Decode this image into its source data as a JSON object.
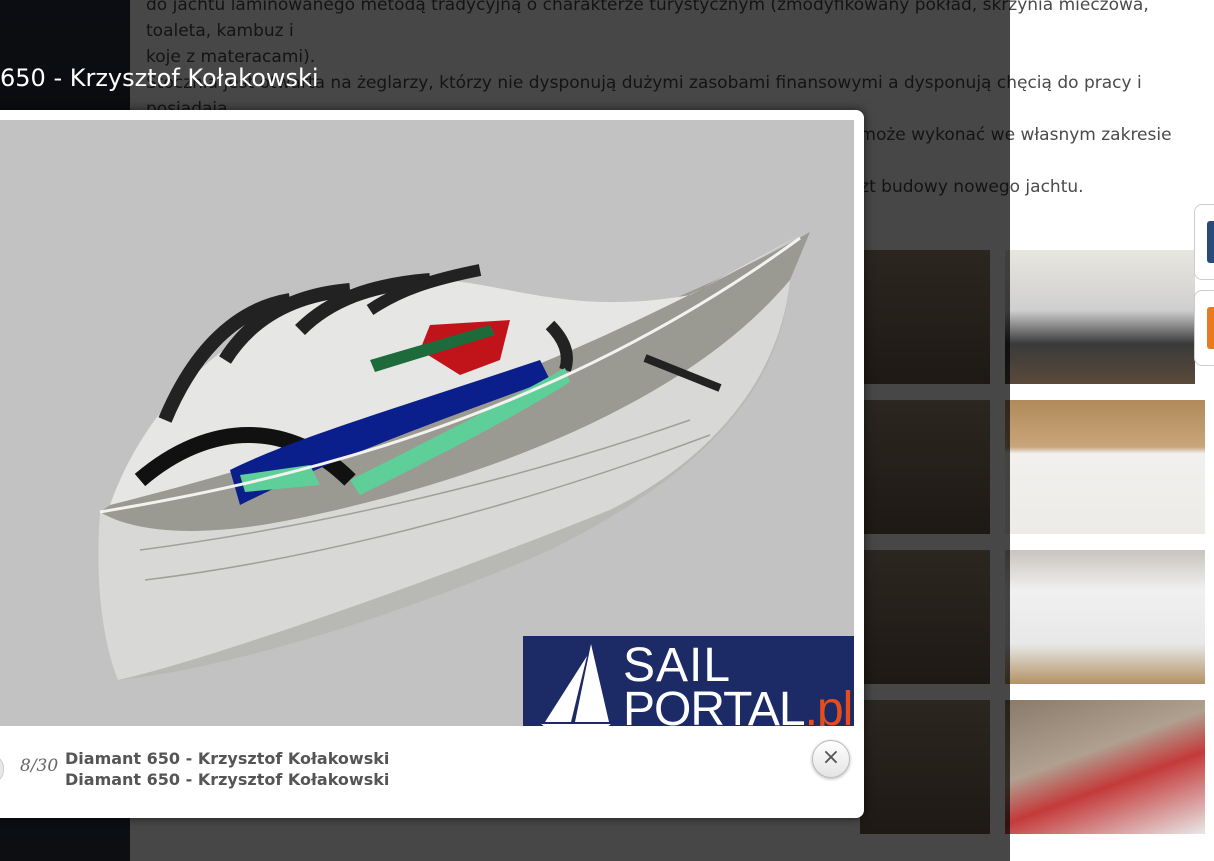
{
  "article": {
    "line1": "do jachtu laminowanego metodą tradycyjną o charakterze turystycznym (zmodyfikowany pokład, skrzynia mieczowa, toaleta, kambuz i",
    "line2": "koje z materacami).",
    "line3": "Stocznia jest otwarta na żeglarzy, którzy nie dysponują dużymi zasobami finansowymi a dysponują chęcią do pracy i posiadają",
    "line4": "umiejętności wykonania podstawowych prac szkutniczych. Zainteresowany skipper może wykonać we własnym zakresie część prac,",
    "line5": "obniżając w ten sposób koszt. Taki model współpracy może znacznie ograniczyć koszt budowy nowego jachtu."
  },
  "lightbox": {
    "title": "650 - Krzysztof Kołakowski",
    "counter": "8/30",
    "caption_line1": "Diamant 650 - Krzysztof Kołakowski",
    "caption_line2": "Diamant 650 - Krzysztof Kołakowski",
    "close_glyph": "×"
  },
  "watermark": {
    "line1": "SAIL",
    "line2_main": "PORTAL",
    "line2_tld": ".pl",
    "bg_color": "#1c2b66",
    "tld_color": "#e74c1c"
  }
}
